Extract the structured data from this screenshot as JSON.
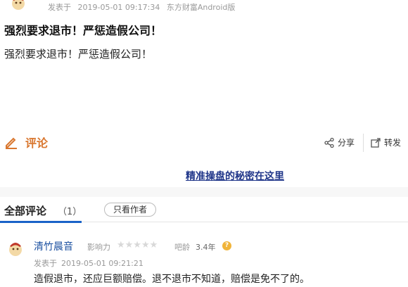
{
  "post": {
    "published_label": "发表于",
    "published_time": "2019-05-01 09:17:34",
    "source": "东方财富Android版",
    "title": "强烈要求退市！严惩造假公司！",
    "body": "强烈要求退市！严惩造假公司！"
  },
  "actions": {
    "comment_label": "评论",
    "share_label": "分享",
    "forward_label": "转发"
  },
  "ad": {
    "link_text": "精准操盘的秘密在这里"
  },
  "comments_section": {
    "title": "全部评论",
    "count": "（1）",
    "author_only_label": "只看作者"
  },
  "comments": [
    {
      "user": "清竹晨音",
      "influence_label": "影响力",
      "influence_stars": 0,
      "stars_text": "★★★★★",
      "age_label": "吧龄",
      "age": "3.4年",
      "published_label": "发表于",
      "published_time": "2019-05-01 09:21:21",
      "text": "造假退市，还应巨额赔偿。退不退市不知道，赔偿是免不了的。"
    }
  ],
  "colors": {
    "comment_accent": "#d9772f",
    "link_blue": "#21378a",
    "user_blue": "#1a4fa0",
    "tab_underline": "#1a63c8",
    "help_icon": "#f0b43a"
  },
  "icons": {
    "avatar": "avatar-icon",
    "comment": "pencil-icon",
    "share": "share-icon",
    "forward": "forward-icon",
    "help": "help-icon"
  }
}
